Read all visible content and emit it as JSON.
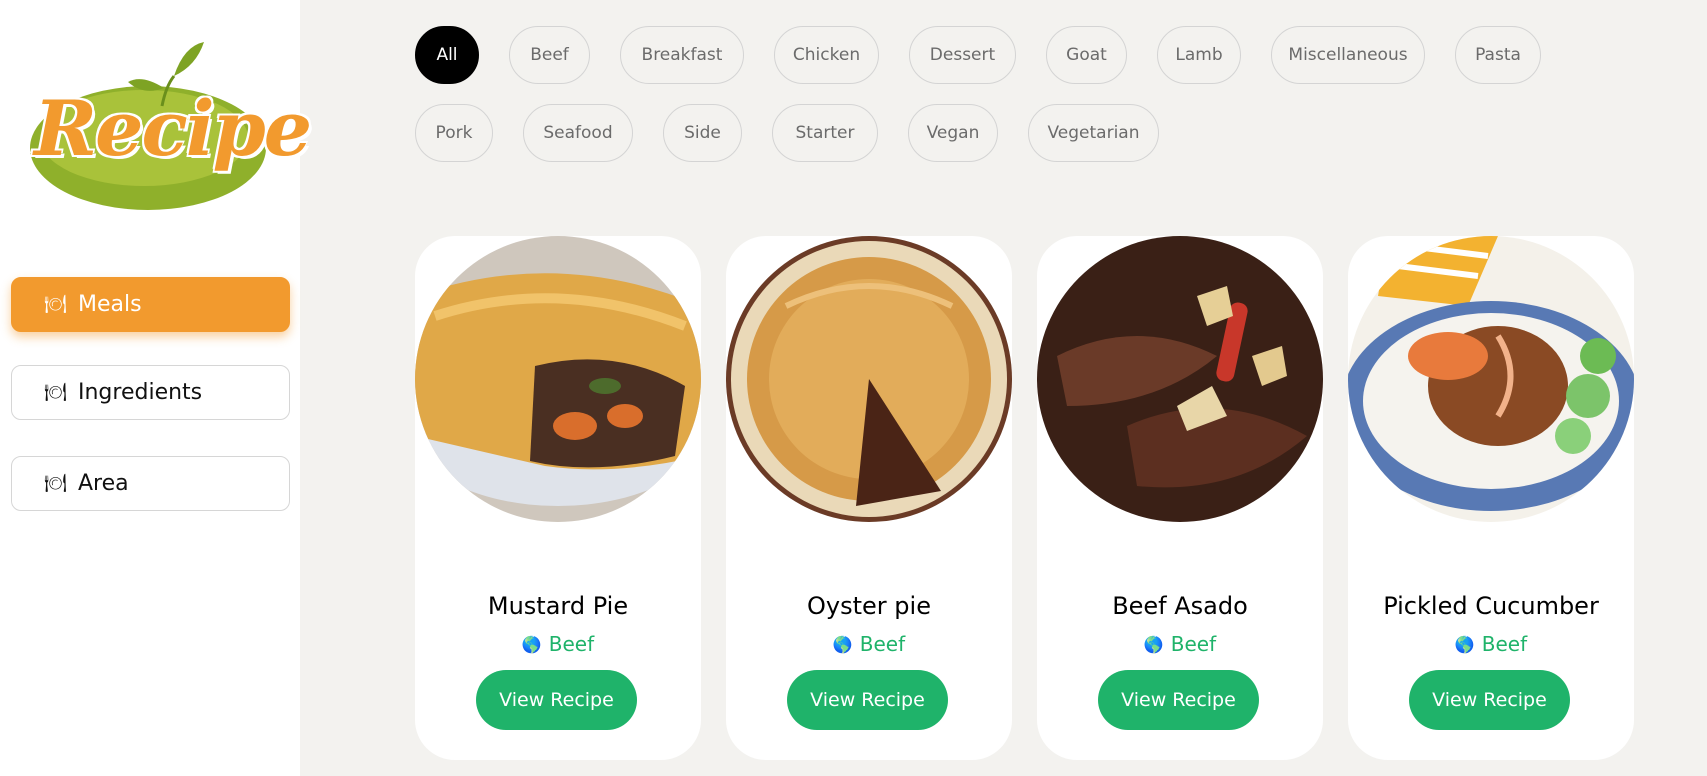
{
  "logo": {
    "text": "Recipe"
  },
  "nav": [
    {
      "label": "Meals",
      "icon": "plate-cutlery-icon"
    },
    {
      "label": "Ingredients",
      "icon": "plate-cutlery-icon"
    },
    {
      "label": "Area",
      "icon": "plate-cutlery-icon"
    }
  ],
  "categories": [
    "All",
    "Beef",
    "Breakfast",
    "Chicken",
    "Dessert",
    "Goat",
    "Lamb",
    "Miscellaneous",
    "Pasta",
    "Pork",
    "Seafood",
    "Side",
    "Starter",
    "Vegan",
    "Vegetarian"
  ],
  "selected_category": "All",
  "meals": [
    {
      "name": "Mustard Pie",
      "area": "Beef",
      "button": "View Recipe"
    },
    {
      "name": "Oyster pie",
      "area": "Beef",
      "button": "View Recipe"
    },
    {
      "name": "Beef Asado",
      "area": "Beef",
      "button": "View Recipe"
    },
    {
      "name": "Pickled Cucumber",
      "area": "Beef",
      "button": "View Recipe"
    }
  ],
  "colors": {
    "accent": "#f29a2e",
    "green": "#1fb36a",
    "page_bg": "#f3f2ef",
    "chip_active": "#000000"
  }
}
